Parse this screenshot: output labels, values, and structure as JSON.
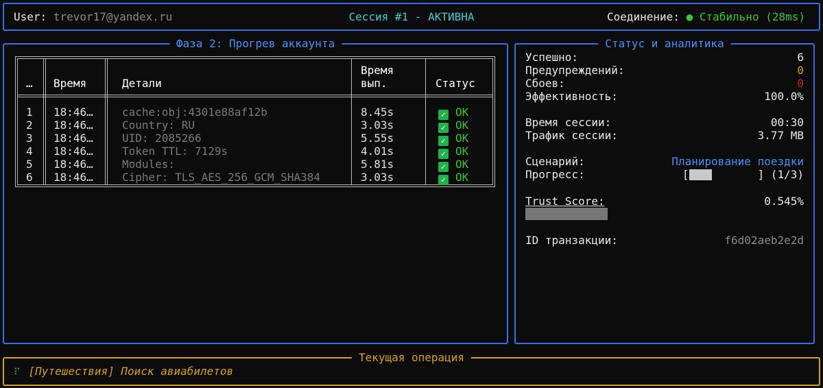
{
  "header": {
    "user_label": "User:",
    "user_value": "trevor17@yandex.ru",
    "session": "Сессия #1 - АКТИВНА",
    "connection_label": "Соединение:",
    "connection_dot": "●",
    "connection_value": "Стабильно (28ms)"
  },
  "phase": {
    "title": "Фаза 2: Прогрев аккаунта",
    "columns": [
      "…",
      "Время",
      "Детали",
      "Время",
      "вып.",
      "Статус"
    ],
    "rows": [
      {
        "num": "1",
        "time": "18:46…",
        "details": "cache:obj:4301e88af12b",
        "duration": "8.45s",
        "status": "OK"
      },
      {
        "num": "2",
        "time": "18:46…",
        "details": "Country: RU",
        "duration": "3.03s",
        "status": "OK"
      },
      {
        "num": "3",
        "time": "18:46…",
        "details": "UID: 2085266",
        "duration": "5.55s",
        "status": "OK"
      },
      {
        "num": "4",
        "time": "18:46…",
        "details": "Token TTL: 7129s",
        "duration": "4.01s",
        "status": "OK"
      },
      {
        "num": "5",
        "time": "18:46…",
        "details": "Modules:",
        "duration": "5.81s",
        "status": "OK"
      },
      {
        "num": "6",
        "time": "18:46…",
        "details": "Cipher: TLS_AES_256_GCM_SHA384",
        "duration": "3.03s",
        "status": "OK"
      }
    ],
    "check_glyph": "✓"
  },
  "status": {
    "title": "Статус и аналитика",
    "success_label": "Успешно:",
    "success_value": "6",
    "warnings_label": "Предупреждений:",
    "warnings_value": "0",
    "failures_label": "Сбоев:",
    "failures_value": "0",
    "efficiency_label": "Эффективность:",
    "efficiency_value": "100.0%",
    "session_time_label": "Время сессии:",
    "session_time_value": "00:30",
    "traffic_label": "Трафик сессии:",
    "traffic_value": "3.77 MB",
    "scenario_label": "Сценарий:",
    "scenario_value": "Планирование поездки",
    "progress_label": "Прогресс:",
    "progress_open": "[",
    "progress_close": "] (1/3)",
    "progress_fraction": 0.333,
    "trust_label": "Trust Score:",
    "trust_value": "0.545%",
    "txid_label": "ID транзакции:",
    "txid_value": "f6d02aeb2e2d"
  },
  "current": {
    "title": "Текущая операция",
    "spinner": "⠏",
    "operation": "[Путешествия] Поиск авиабилетов"
  },
  "colors": {
    "border_blue": "#3b6ee8",
    "accent_cyan": "#4ec9d4",
    "ok_green": "#3ec43e",
    "warn_yellow": "#d7a21c",
    "fail_red": "#d42323"
  }
}
